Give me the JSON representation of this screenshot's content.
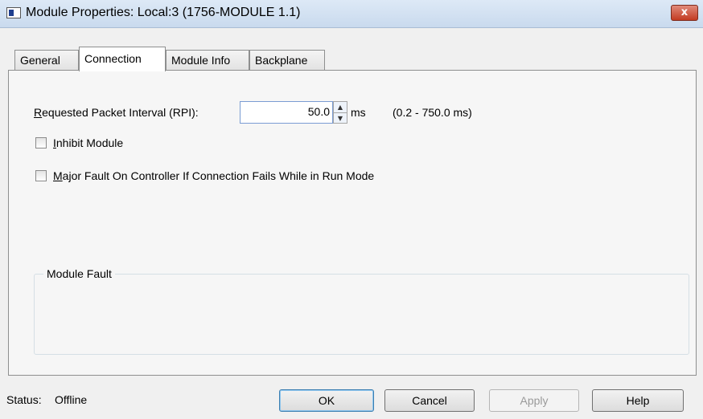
{
  "window": {
    "title": "Module Properties: Local:3 (1756-MODULE 1.1)",
    "close_glyph": "x"
  },
  "tabs": [
    {
      "label": "General",
      "active": false
    },
    {
      "label": "Connection",
      "active": true
    },
    {
      "label": "Module Info",
      "active": false
    },
    {
      "label": "Backplane",
      "active": false
    }
  ],
  "connection": {
    "rpi_label_prefix": "R",
    "rpi_label_rest": "equested Packet Interval (RPI):",
    "rpi_value": "50.0",
    "rpi_unit": "ms",
    "rpi_range": "(0.2 - 750.0 ms)",
    "inhibit_prefix": "I",
    "inhibit_rest": "nhibit Module",
    "inhibit_checked": false,
    "major_fault_prefix": "M",
    "major_fault_rest": "ajor Fault On Controller If Connection Fails While in Run Mode",
    "major_fault_checked": false,
    "module_fault_title": "Module Fault"
  },
  "status": {
    "label": "Status:",
    "value": "Offline"
  },
  "buttons": {
    "ok": "OK",
    "cancel": "Cancel",
    "apply": "Apply",
    "help": "Help"
  }
}
